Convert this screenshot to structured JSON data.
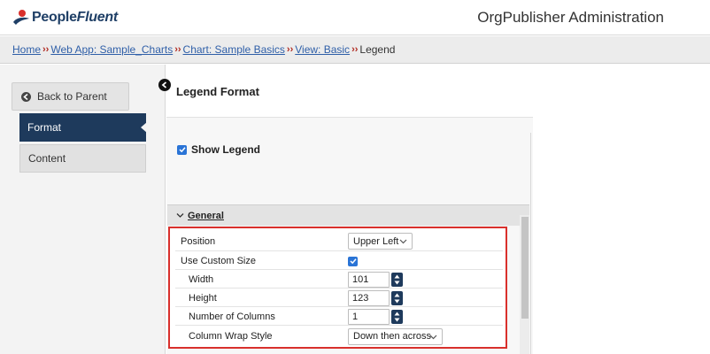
{
  "header": {
    "logo_text_part1": "People",
    "logo_text_part2": "Fluent",
    "app_title": "OrgPublisher Administration"
  },
  "breadcrumb": {
    "items": [
      "Home",
      "Web App: Sample_Charts",
      "Chart: Sample Basics",
      "View: Basic"
    ],
    "current": "Legend",
    "separator": "››"
  },
  "sidebar": {
    "back_label": "Back to Parent",
    "items": [
      {
        "label": "Format",
        "active": true
      },
      {
        "label": "Content",
        "active": false
      }
    ]
  },
  "main": {
    "title": "Legend Format",
    "show_legend": {
      "label": "Show Legend",
      "checked": true
    },
    "section": {
      "label": "General",
      "expanded": true
    },
    "properties": {
      "position": {
        "label": "Position",
        "value": "Upper Left"
      },
      "use_custom_size": {
        "label": "Use Custom Size",
        "checked": true
      },
      "width": {
        "label": "Width",
        "value": "101"
      },
      "height": {
        "label": "Height",
        "value": "123"
      },
      "columns": {
        "label": "Number of Columns",
        "value": "1"
      },
      "wrap_style": {
        "label": "Column Wrap Style",
        "value": "Down then across"
      }
    }
  },
  "colors": {
    "nav_active": "#1e3a5c",
    "highlight_border": "#d9302c",
    "link": "#2f5fa8",
    "checkbox": "#2a74d6"
  }
}
